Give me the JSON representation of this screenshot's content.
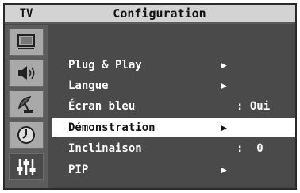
{
  "header": {
    "tv_label": "TV",
    "title": "Configuration"
  },
  "sidebar": {
    "icons": [
      "picture-icon",
      "speaker-icon",
      "antenna-icon",
      "clock-icon",
      "settings-sliders-icon"
    ],
    "active_index": 4
  },
  "menu": {
    "items": [
      {
        "label": "Plug & Play",
        "arrow": "▶",
        "value": ""
      },
      {
        "label": "Langue",
        "arrow": "▶",
        "value": ""
      },
      {
        "label": "Écran bleu",
        "arrow": "",
        "value": ": Oui"
      },
      {
        "label": "Démonstration",
        "arrow": "▶",
        "value": ""
      },
      {
        "label": "Inclinaison",
        "arrow": "",
        "value": ":  0"
      },
      {
        "label": "PIP",
        "arrow": "▶",
        "value": ""
      }
    ],
    "selected_index": 3
  },
  "colors": {
    "frame": "#4a4a4a",
    "header": "#d3d3d3",
    "icon_bg": "#a9a9a9",
    "highlight": "#ffffff"
  }
}
